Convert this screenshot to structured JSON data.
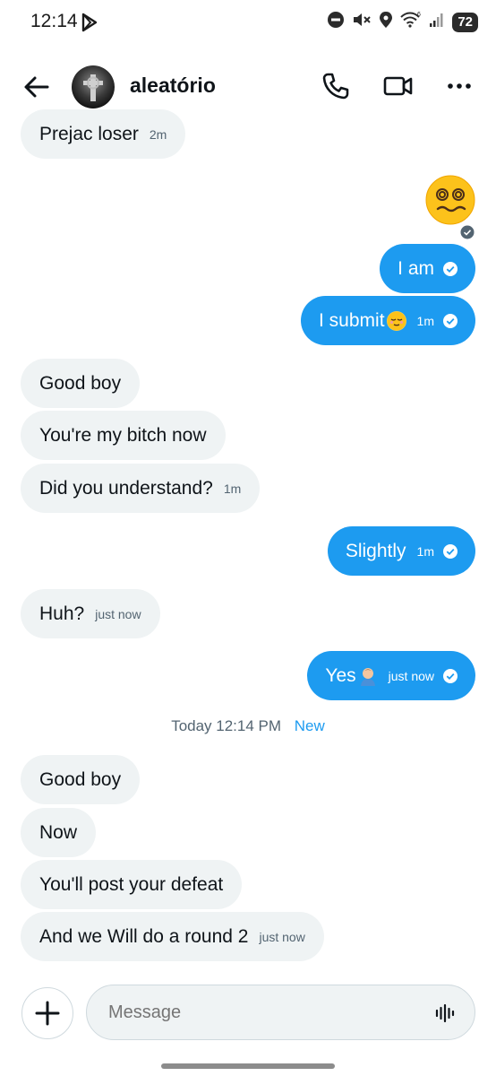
{
  "status_bar": {
    "time": "12:14",
    "battery": "72"
  },
  "header": {
    "username": "aleatório"
  },
  "messages": [
    {
      "text": "Prejac loser",
      "time": "2m"
    },
    {
      "text": "I am"
    },
    {
      "text": "I submit",
      "time": "1m"
    },
    {
      "text": "Good boy"
    },
    {
      "text": "You're my bitch now"
    },
    {
      "text": "Did you understand?",
      "time": "1m"
    },
    {
      "text": "Slightly",
      "time": "1m"
    },
    {
      "text": "Huh?",
      "time": "just now"
    },
    {
      "text": "Yes",
      "time": "just now"
    },
    {
      "text": "Good boy"
    },
    {
      "text": "Now"
    },
    {
      "text": "You'll post your defeat"
    },
    {
      "text": "And we Will do a round 2",
      "time": "just now"
    }
  ],
  "divider": {
    "label": "Today 12:14 PM",
    "new_label": "New"
  },
  "composer": {
    "placeholder": "Message"
  }
}
